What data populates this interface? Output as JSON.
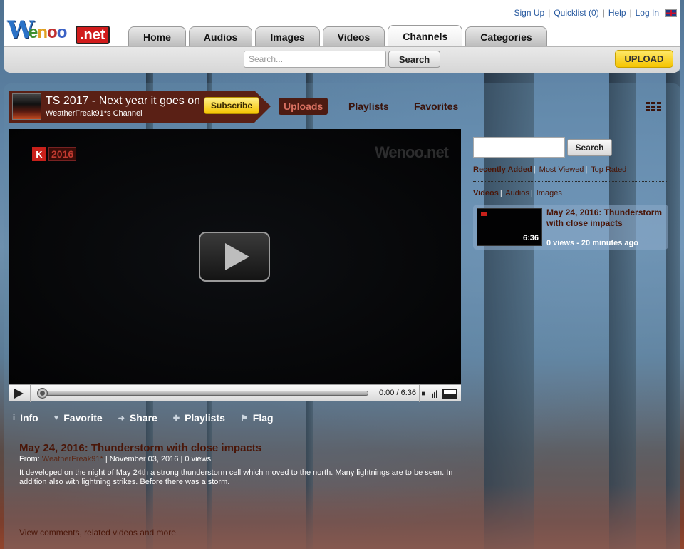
{
  "top_links": {
    "sign_up": "Sign Up",
    "quicklist": "Quicklist (0)",
    "help": "Help",
    "log_in": "Log In"
  },
  "logo": {
    "w": "W",
    "enoo": [
      "e",
      "n",
      "o",
      "o"
    ],
    "net": ".net"
  },
  "nav_tabs": [
    "Home",
    "Audios",
    "Images",
    "Videos",
    "Channels",
    "Categories"
  ],
  "active_tab": "Channels",
  "search": {
    "placeholder": "Search...",
    "button": "Search"
  },
  "upload_label": "UPLOAD",
  "channel": {
    "title": "TS 2017 - Next year it goes on",
    "subtitle": "WeatherFreak91*s Channel",
    "subscribe_label": "Subscribe",
    "tabs": [
      "Uploads",
      "Playlists",
      "Favorites"
    ],
    "active_tab": "Uploads"
  },
  "player": {
    "overlay_k": "K",
    "overlay_year": "2016",
    "watermark": "Wenoo.net",
    "time": "0:00 / 6:36"
  },
  "actions": [
    {
      "icon": "info-icon",
      "glyph": "i",
      "label": "Info"
    },
    {
      "icon": "heart-icon",
      "glyph": "♥",
      "label": "Favorite"
    },
    {
      "icon": "share-icon",
      "glyph": "➜",
      "label": "Share"
    },
    {
      "icon": "plus-icon",
      "glyph": "✚",
      "label": "Playlists"
    },
    {
      "icon": "flag-icon",
      "glyph": "⚑",
      "label": "Flag"
    }
  ],
  "video": {
    "title": "May 24, 2016: Thunderstorm with close impacts",
    "from_label": "From:",
    "author": "WeatherFreak91*",
    "date": "November 03, 2016",
    "views": "0 views",
    "description": "It developed on the night of May 24th a strong thunderstorm cell which moved to the north. Many lightnings are to be seen. In addition also with lightning strikes. Before there was a storm.",
    "more_link": "View comments, related videos and more"
  },
  "sidebar": {
    "search_button": "Search",
    "filters": [
      "Recently Added",
      "Most Viewed",
      "Top Rated"
    ],
    "active_filter": "Recently Added",
    "types": [
      "Videos",
      "Audios",
      "Images"
    ],
    "active_type": "Videos",
    "card": {
      "duration": "6:36",
      "title": "May 24, 2016: Thunderstorm with close impacts",
      "meta": "0 views - 20 minutes ago"
    }
  },
  "colors": {
    "brand_dark_red": "#5a2015",
    "upload_yellow": "#f5c400",
    "link_blue": "#285aa0"
  }
}
